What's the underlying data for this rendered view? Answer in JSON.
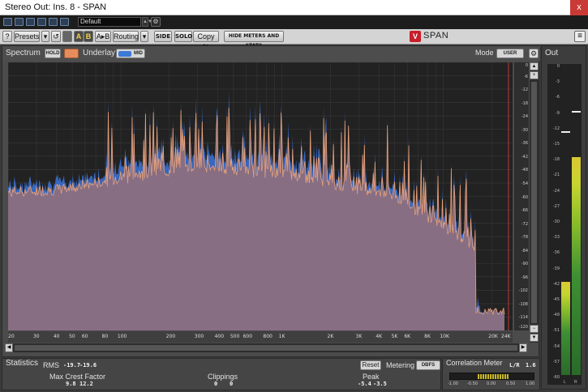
{
  "window": {
    "title": "Stereo Out: Ins. 8 - SPAN",
    "close_label": "x"
  },
  "host": {
    "preset": "Default"
  },
  "toolbar": {
    "help": "?",
    "presets": "Presets",
    "a": "A",
    "b": "B",
    "a_to_b": "A▸B",
    "routing": "Routing",
    "side": "SIDE",
    "solo": "SOLO",
    "copy_to": "Copy to",
    "hide_meters": "HIDE METERS AND STATS",
    "brand": "SPAN"
  },
  "spectrum": {
    "label": "Spectrum",
    "hold": "HOLD",
    "underlay_label": "Underlay",
    "mid": "MID",
    "mode_label": "Mode",
    "mode_value": "USER",
    "colors": {
      "main": "#e9a17a",
      "underlay": "#3a6fcf",
      "fill": "#8b6f80"
    }
  },
  "y_axis_labels": [
    "0",
    "-6",
    "-12",
    "-18",
    "-24",
    "-30",
    "-36",
    "-42",
    "-48",
    "-54",
    "-60",
    "-66",
    "-72",
    "-78",
    "-84",
    "-90",
    "-96",
    "-102",
    "-108",
    "-114",
    "-120"
  ],
  "x_axis_labels": [
    "20",
    "30",
    "40",
    "50",
    "60",
    "80",
    "100",
    "200",
    "300",
    "400",
    "500",
    "600",
    "800",
    "1K",
    "2K",
    "3K",
    "4K",
    "5K",
    "6K",
    "8K",
    "10K",
    "20K",
    "24K"
  ],
  "out_meter": {
    "label": "Out",
    "scale": [
      "0",
      "-3",
      "-6",
      "-9",
      "-12",
      "-15",
      "-18",
      "-21",
      "-24",
      "-27",
      "-30",
      "-33",
      "-36",
      "-39",
      "-42",
      "-45",
      "-48",
      "-51",
      "-54",
      "-57",
      "-60"
    ],
    "channels": [
      "L",
      "R"
    ],
    "levels_db": [
      -42,
      -18
    ]
  },
  "statistics": {
    "label": "Statistics",
    "rms_label": "RMS",
    "rms_l": "-19.7",
    "rms_r": "-19.6",
    "max_crest_label": "Max Crest Factor",
    "crest_l": "9.8",
    "crest_r": "12.2",
    "clippings_label": "Clippings",
    "clip_l": "0",
    "clip_r": "0",
    "peak_label": "Peak",
    "peak_l": "-5.4",
    "peak_r": "-3.5",
    "reset": "Reset",
    "metering_label": "Metering",
    "metering_value": "DBFS"
  },
  "correlation": {
    "label": "Correlation Meter",
    "mode": "L/R",
    "mode_val": "1.6",
    "ticks": [
      "-1.00",
      "-0.50",
      "0.00",
      "0.50",
      "1.00"
    ]
  }
}
